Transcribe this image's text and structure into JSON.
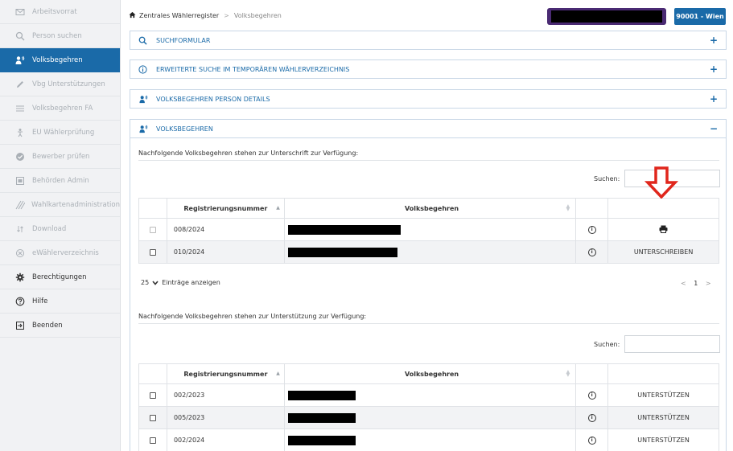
{
  "sidebar": {
    "items": [
      {
        "label": "Arbeitsvorrat",
        "icon": "envelope-icon"
      },
      {
        "label": "Person suchen",
        "icon": "search-icon"
      },
      {
        "label": "Volksbegehren",
        "icon": "people-speak-icon"
      },
      {
        "label": "Vbg Unterstützungen",
        "icon": "pencil-icon"
      },
      {
        "label": "Volksbegehren FA",
        "icon": "list-icon"
      },
      {
        "label": "EU Wählerprüfung",
        "icon": "person-icon"
      },
      {
        "label": "Bewerber prüfen",
        "icon": "check-circle-icon"
      },
      {
        "label": "Behörden Admin",
        "icon": "id-card-icon"
      },
      {
        "label": "Wahlkartenadministration",
        "icon": "slashes-icon"
      },
      {
        "label": "Download",
        "icon": "download-icon"
      },
      {
        "label": "eWählerverzeichnis",
        "icon": "x-circle-icon"
      },
      {
        "label": "Berechtigungen",
        "icon": "gear-icon"
      },
      {
        "label": "Hilfe",
        "icon": "help-icon"
      },
      {
        "label": "Beenden",
        "icon": "logout-icon"
      }
    ]
  },
  "header": {
    "breadcrumb_home": "Zentrales Wählerregister",
    "breadcrumb_sep": ">",
    "breadcrumb_current": "Volksbegehren",
    "region": "90001 - Wien"
  },
  "panels": {
    "suchformular": {
      "title": "SUCHFORMULAR",
      "toggle": "+"
    },
    "erweitert": {
      "title": "ERWEITERTE SUCHE IM TEMPORÄREN WÄHLERVERZEICHNIS",
      "toggle": "+"
    },
    "details": {
      "title": "VOLKSBEGEHREN PERSON DETAILS",
      "toggle": "+"
    },
    "volksbegehren": {
      "title": "VOLKSBEGEHREN",
      "toggle": "−"
    }
  },
  "signature": {
    "intro": "Nachfolgende Volksbegehren stehen zur Unterschrift zur Verfügung:",
    "search_label": "Suchen:",
    "columns": [
      "Registrierungsnummer",
      "Volksbegehren"
    ],
    "rows": [
      {
        "reg": "008/2024",
        "action": "",
        "action_icon": "printer-icon",
        "checkbox_disabled": true,
        "redact_width": 140
      },
      {
        "reg": "010/2024",
        "action": "UNTERSCHREIBEN",
        "checkbox_disabled": false,
        "redact_width": 136
      }
    ],
    "entries_value": "25",
    "entries_label": "Einträge anzeigen",
    "pager_prev": "<",
    "pager_page": "1",
    "pager_next": ">"
  },
  "support": {
    "intro": "Nachfolgende Volksbegehren stehen zur Unterstützung zur Verfügung:",
    "search_label": "Suchen:",
    "columns": [
      "Registrierungsnummer",
      "Volksbegehren"
    ],
    "rows": [
      {
        "reg": "002/2023",
        "action": "UNTERSTÜTZEN",
        "redact_width": 84
      },
      {
        "reg": "005/2023",
        "action": "UNTERSTÜTZEN",
        "redact_width": 84
      },
      {
        "reg": "002/2024",
        "action": "UNTERSTÜTZEN",
        "redact_width": 84
      }
    ]
  },
  "colors": {
    "accent": "#1a6aa8",
    "user_box": "#4a2a73",
    "arrow": "#e0261c"
  }
}
